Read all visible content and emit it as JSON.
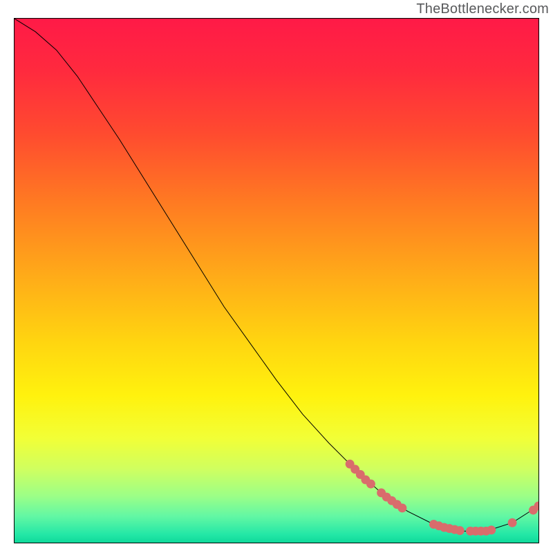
{
  "watermark": "TheBottlenecker.com",
  "colors": {
    "gradient_stops": [
      {
        "offset": 0.0,
        "color": "#ff1a47"
      },
      {
        "offset": 0.1,
        "color": "#ff2a3e"
      },
      {
        "offset": 0.22,
        "color": "#ff4b2f"
      },
      {
        "offset": 0.35,
        "color": "#ff7a22"
      },
      {
        "offset": 0.5,
        "color": "#ffae18"
      },
      {
        "offset": 0.62,
        "color": "#ffd610"
      },
      {
        "offset": 0.72,
        "color": "#fff20e"
      },
      {
        "offset": 0.8,
        "color": "#f2ff36"
      },
      {
        "offset": 0.86,
        "color": "#cfff60"
      },
      {
        "offset": 0.91,
        "color": "#9dff86"
      },
      {
        "offset": 0.95,
        "color": "#62f7a4"
      },
      {
        "offset": 0.985,
        "color": "#22e7a6"
      },
      {
        "offset": 1.0,
        "color": "#0fd99b"
      }
    ],
    "line": "#000000",
    "marker": "#d96c6c"
  },
  "chart_data": {
    "type": "line",
    "title": "",
    "xlabel": "",
    "ylabel": "",
    "xlim": [
      0,
      100
    ],
    "ylim": [
      0,
      100
    ],
    "curve": [
      {
        "x": 0,
        "y": 100
      },
      {
        "x": 4,
        "y": 97.5
      },
      {
        "x": 8,
        "y": 94
      },
      {
        "x": 12,
        "y": 89
      },
      {
        "x": 16,
        "y": 83
      },
      {
        "x": 20,
        "y": 77
      },
      {
        "x": 25,
        "y": 69
      },
      {
        "x": 30,
        "y": 61
      },
      {
        "x": 35,
        "y": 53
      },
      {
        "x": 40,
        "y": 45
      },
      {
        "x": 45,
        "y": 38
      },
      {
        "x": 50,
        "y": 31
      },
      {
        "x": 55,
        "y": 24.5
      },
      {
        "x": 60,
        "y": 19
      },
      {
        "x": 65,
        "y": 14
      },
      {
        "x": 70,
        "y": 9.5
      },
      {
        "x": 75,
        "y": 6
      },
      {
        "x": 80,
        "y": 3.5
      },
      {
        "x": 85,
        "y": 2.2
      },
      {
        "x": 90,
        "y": 2.2
      },
      {
        "x": 95,
        "y": 3.8
      },
      {
        "x": 100,
        "y": 7
      }
    ],
    "marker_clusters": [
      {
        "x": 64,
        "y": 15.0
      },
      {
        "x": 65,
        "y": 14.0
      },
      {
        "x": 66,
        "y": 13.0
      },
      {
        "x": 67,
        "y": 12.0
      },
      {
        "x": 68,
        "y": 11.2
      },
      {
        "x": 70,
        "y": 9.5
      },
      {
        "x": 71,
        "y": 8.7
      },
      {
        "x": 72,
        "y": 8.0
      },
      {
        "x": 73,
        "y": 7.3
      },
      {
        "x": 74,
        "y": 6.6
      },
      {
        "x": 80,
        "y": 3.5
      },
      {
        "x": 81,
        "y": 3.2
      },
      {
        "x": 82,
        "y": 2.9
      },
      {
        "x": 83,
        "y": 2.7
      },
      {
        "x": 84,
        "y": 2.5
      },
      {
        "x": 85,
        "y": 2.3
      },
      {
        "x": 87,
        "y": 2.2
      },
      {
        "x": 88,
        "y": 2.2
      },
      {
        "x": 89,
        "y": 2.2
      },
      {
        "x": 90,
        "y": 2.2
      },
      {
        "x": 91,
        "y": 2.4
      },
      {
        "x": 95,
        "y": 3.8
      },
      {
        "x": 99,
        "y": 6.2
      },
      {
        "x": 100,
        "y": 7.0
      }
    ]
  }
}
